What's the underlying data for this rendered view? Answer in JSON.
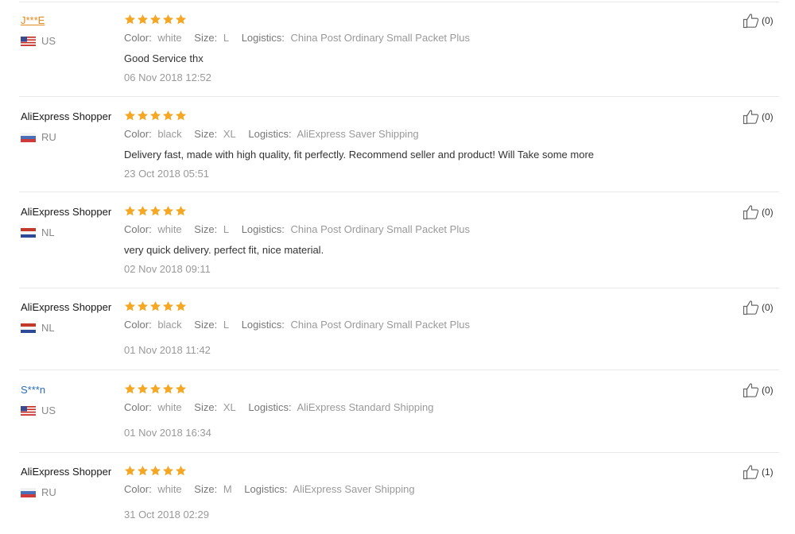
{
  "labels": {
    "color": "Color:",
    "size": "Size:",
    "logistics": "Logistics:"
  },
  "colors": {
    "star": "#f5a623",
    "link_orange": "#e08a20",
    "link_blue": "#2a6db5"
  },
  "reviews": [
    {
      "name": "J***E",
      "name_style": "orange-link",
      "country": "US",
      "flag": "us-flag-icon",
      "rating": 5,
      "color": "white",
      "size": "L",
      "logistics": "China Post Ordinary Small Packet Plus",
      "feedback": "Good Service thx",
      "date": "06 Nov 2018 12:52",
      "useful": "(0)"
    },
    {
      "name": "AliExpress Shopper",
      "name_style": "plain",
      "country": "RU",
      "flag": "ru-flag-icon",
      "rating": 5,
      "color": "black",
      "size": "XL",
      "logistics": "AliExpress Saver Shipping",
      "feedback": "Delivery fast, made with high quality, fit perfectly. Recommend seller and product! Will Take some more",
      "date": "23 Oct 2018 05:51",
      "useful": "(0)"
    },
    {
      "name": "AliExpress Shopper",
      "name_style": "plain",
      "country": "NL",
      "flag": "nl-flag-icon",
      "rating": 5,
      "color": "white",
      "size": "L",
      "logistics": "China Post Ordinary Small Packet Plus",
      "feedback": "very quick delivery. perfect fit, nice material.",
      "date": "02 Nov 2018 09:11",
      "useful": "(0)"
    },
    {
      "name": "AliExpress Shopper",
      "name_style": "plain",
      "country": "NL",
      "flag": "nl-flag-icon",
      "rating": 5,
      "color": "black",
      "size": "L",
      "logistics": "China Post Ordinary Small Packet Plus",
      "feedback": "",
      "date": "01 Nov 2018 11:42",
      "useful": "(0)"
    },
    {
      "name": "S***n",
      "name_style": "blue",
      "country": "US",
      "flag": "us-flag-icon",
      "rating": 5,
      "color": "white",
      "size": "XL",
      "logistics": "AliExpress Standard Shipping",
      "feedback": "",
      "date": "01 Nov 2018 16:34",
      "useful": "(0)"
    },
    {
      "name": "AliExpress Shopper",
      "name_style": "plain",
      "country": "RU",
      "flag": "ru-flag-icon",
      "rating": 5,
      "color": "white",
      "size": "M",
      "logistics": "AliExpress Saver Shipping",
      "feedback": "",
      "date": "31 Oct 2018 02:29",
      "useful": "(1)"
    }
  ]
}
